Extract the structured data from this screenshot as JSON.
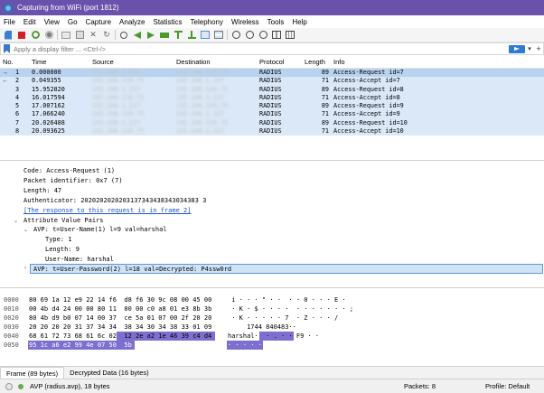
{
  "window": {
    "title": "Capturing from WiFi (port 1812)"
  },
  "menu": [
    "File",
    "Edit",
    "View",
    "Go",
    "Capture",
    "Analyze",
    "Statistics",
    "Telephony",
    "Wireless",
    "Tools",
    "Help"
  ],
  "filter": {
    "placeholder": "Apply a display filter ... <Ctrl-/>"
  },
  "packet_list": {
    "columns": [
      "No.",
      "Time",
      "Source",
      "Destination",
      "Protocol",
      "Length",
      "Info"
    ],
    "rows": [
      {
        "no": "1",
        "time": "0.000000",
        "source": "192.168.1.227",
        "destination": "192.168.110.75",
        "protocol": "RADIUS",
        "length": "89",
        "info": "Access-Request id=7",
        "marker": "→"
      },
      {
        "no": "2",
        "time": "0.049355",
        "source": "192.168.110.75",
        "destination": "192.168.1.227",
        "protocol": "RADIUS",
        "length": "71",
        "info": "Access-Accept id=7",
        "marker": "←"
      },
      {
        "no": "3",
        "time": "15.952820",
        "source": "192.168.1.227",
        "destination": "192.168.110.75",
        "protocol": "RADIUS",
        "length": "89",
        "info": "Access-Request id=8",
        "marker": ""
      },
      {
        "no": "4",
        "time": "16.017594",
        "source": "192.168.110.75",
        "destination": "192.168.1.227",
        "protocol": "RADIUS",
        "length": "71",
        "info": "Access-Accept id=8",
        "marker": ""
      },
      {
        "no": "5",
        "time": "17.007162",
        "source": "192.168.1.227",
        "destination": "192.168.110.75",
        "protocol": "RADIUS",
        "length": "89",
        "info": "Access-Request id=9",
        "marker": ""
      },
      {
        "no": "6",
        "time": "17.066240",
        "source": "192.168.110.75",
        "destination": "192.168.1.227",
        "protocol": "RADIUS",
        "length": "71",
        "info": "Access-Accept id=9",
        "marker": ""
      },
      {
        "no": "7",
        "time": "20.026488",
        "source": "192.168.1.227",
        "destination": "192.168.110.75",
        "protocol": "RADIUS",
        "length": "89",
        "info": "Access-Request id=10",
        "marker": ""
      },
      {
        "no": "8",
        "time": "20.093625",
        "source": "192.168.110.75",
        "destination": "192.168.1.227",
        "protocol": "RADIUS",
        "length": "71",
        "info": "Access-Accept id=10",
        "marker": ""
      }
    ]
  },
  "details": {
    "code": "Code: Access-Request (1)",
    "packet_identifier": "Packet identifier: 0x7 (7)",
    "length": "Length: 47",
    "authenticator": "Authenticator: 2020202020203137343438343034383 3",
    "response_link": "[The response to this request is in frame 2]",
    "avp_header": "Attribute Value Pairs",
    "avp_username": "AVP: t=User-Name(1) l=9 val=harshal",
    "type": "Type: 1",
    "avp_length": "Length: 9",
    "username": "User-Name: harshal",
    "avp_password": "AVP: t=User-Password(2) l=18 val=Decrypted: P4ssw0rd"
  },
  "bytes": {
    "rows": [
      {
        "offset": "0000",
        "hex": "80 69 1a 12 e9 22 14 f6  d8 f6 30 9c 08 00 45 00",
        "ascii": " i · · · \" · ·  · · 0 · · · E ·"
      },
      {
        "offset": "0010",
        "hex": "00 4b d4 24 00 00 80 11  00 00 c0 a8 01 e3 8b 3b",
        "ascii": " · K · $ · · · ·  · · · · · · · ;"
      },
      {
        "offset": "0020",
        "hex": "80 4b d9 b0 07 14 00 37  ce 5a 01 07 00 2f 20 20",
        "ascii": " · K · · · · · 7  · Z · · · / "
      },
      {
        "offset": "0030",
        "hex": "20 20 20 20 31 37 34 34  38 34 30 34 38 33 01 09",
        "ascii": "     1744 840483··"
      },
      {
        "offset": "0040",
        "hex": "68 61 72 73 68 61 6c 02  12 2e a2 1e 46 39 c4 d4",
        "ascii": "harshal·  · . · · F9 · ·"
      },
      {
        "offset": "0050",
        "hex": "95 1c a6 e2 99 4e 07 50  5b",
        "ascii": "· · · · · N · P  ["
      }
    ]
  },
  "tabs": [
    "Frame (89 bytes)",
    "Decrypted Data (16 bytes)"
  ],
  "status": {
    "field": "AVP (radius.avp), 18 bytes",
    "packets": "Packets: 8",
    "profile": "Profile: Default"
  },
  "colors": {
    "title_bar": "#6a52ac",
    "row_bg": "#dbe8f7",
    "selected_row": "#b8d3f0",
    "byte_highlight": "#7d6fcf",
    "link": "#1a55c6"
  }
}
